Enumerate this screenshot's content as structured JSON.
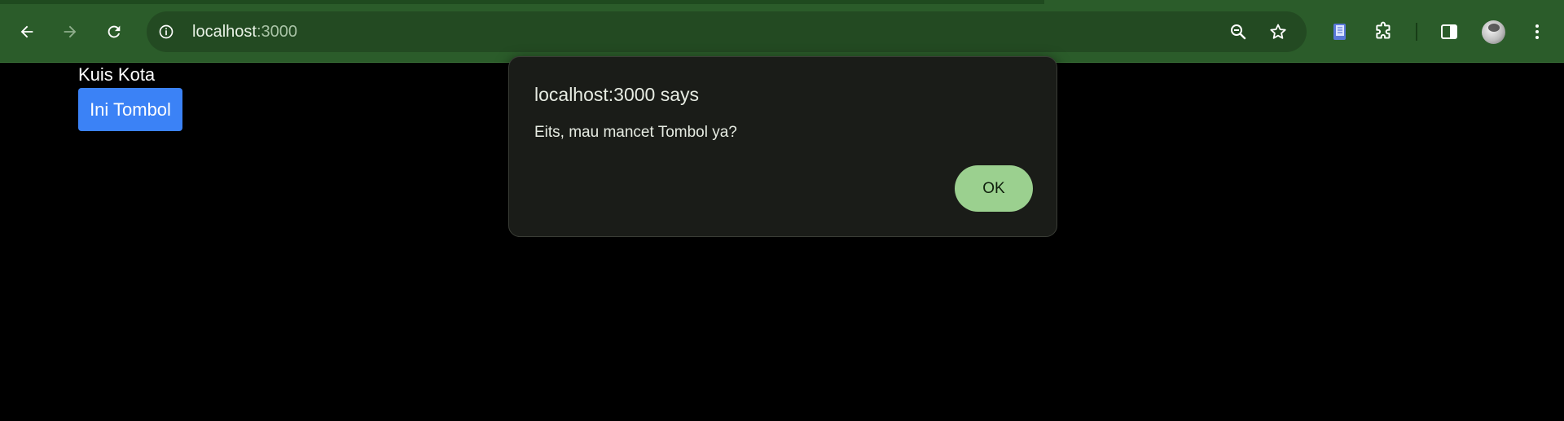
{
  "browser": {
    "url_host": "localhost",
    "url_port": ":3000",
    "icons": {
      "back": "arrow-left-icon",
      "forward": "arrow-right-icon",
      "reload": "reload-icon",
      "site_info": "info-icon",
      "zoom": "zoom-out-icon",
      "bookmark": "star-icon",
      "extension_book": "book-extension-icon",
      "extensions": "puzzle-icon",
      "side_panel": "side-panel-icon",
      "profile": "avatar",
      "menu": "kebab-menu-icon"
    },
    "colors": {
      "toolbar": "#2b5c2a",
      "omnibox": "#234a22"
    }
  },
  "page": {
    "title": "Kuis Kota",
    "button_label": "Ini Tombol",
    "colors": {
      "background": "#000000",
      "button": "#3b82f6"
    }
  },
  "dialog": {
    "title": "localhost:3000 says",
    "message": "Eits, mau mancet Tombol ya?",
    "ok_label": "OK",
    "colors": {
      "background": "#1a1c18",
      "ok_button": "#9bd08f"
    }
  }
}
